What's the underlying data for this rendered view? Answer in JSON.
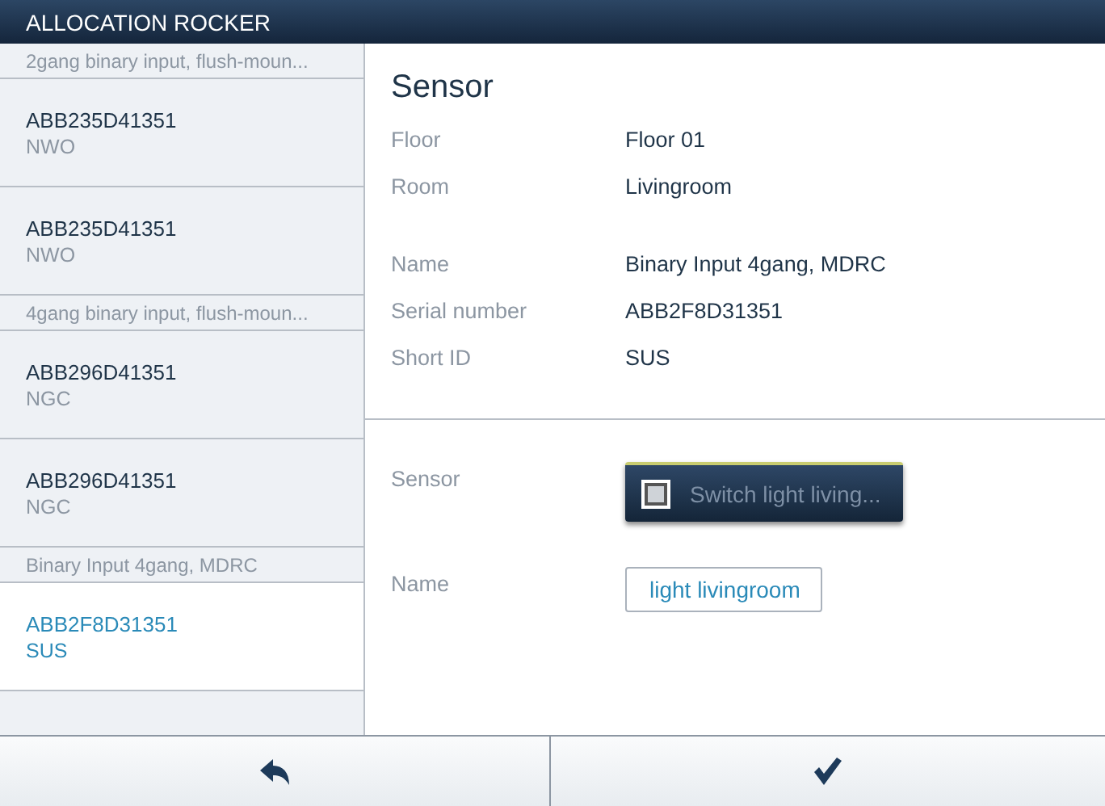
{
  "window": {
    "title": "ALLOCATION ROCKER"
  },
  "sidebar": {
    "groups": [
      {
        "label": "2gang binary input, flush-moun...",
        "items": [
          {
            "serial": "ABB235D41351",
            "short_id": "NWO",
            "selected": false
          },
          {
            "serial": "ABB235D41351",
            "short_id": "NWO",
            "selected": false
          }
        ]
      },
      {
        "label": "4gang binary input, flush-moun...",
        "items": [
          {
            "serial": "ABB296D41351",
            "short_id": "NGC",
            "selected": false
          },
          {
            "serial": "ABB296D41351",
            "short_id": "NGC",
            "selected": false
          }
        ]
      },
      {
        "label": "Binary Input 4gang, MDRC",
        "items": [
          {
            "serial": "ABB2F8D31351",
            "short_id": "SUS",
            "selected": true
          }
        ]
      }
    ]
  },
  "details": {
    "heading": "Sensor",
    "field_groups": [
      [
        {
          "label": "Floor",
          "value": "Floor 01"
        },
        {
          "label": "Room",
          "value": "Livingroom"
        }
      ],
      [
        {
          "label": "Name",
          "value": "Binary Input 4gang, MDRC"
        },
        {
          "label": "Serial number",
          "value": "ABB2F8D31351"
        },
        {
          "label": "Short ID",
          "value": "SUS"
        }
      ]
    ]
  },
  "form": {
    "sensor": {
      "label": "Sensor",
      "button": "Switch light living..."
    },
    "name": {
      "label": "Name",
      "value": "light livingroom"
    }
  },
  "footer": {
    "buttons": [
      {
        "kind": "back"
      },
      {
        "kind": "confirm"
      }
    ]
  }
}
